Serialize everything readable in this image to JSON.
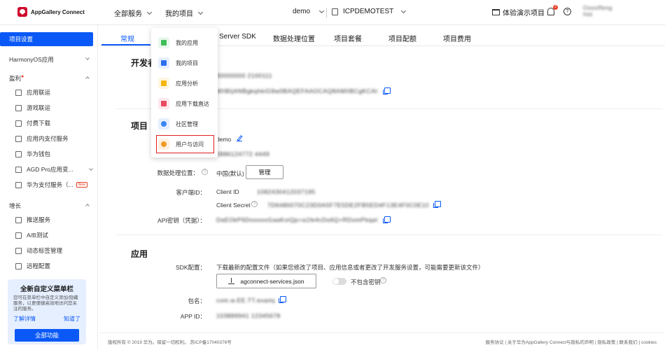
{
  "header": {
    "brand": "AppGallery Connect",
    "nav_all_services": "全部服务",
    "nav_my_projects": "我的项目",
    "app_selector": "demo",
    "project_selector": "ICPDEMOTEST",
    "demo_project": "体验演示项目",
    "notification_count": "2",
    "help": "?",
    "user_name": "Ooooffeng",
    "user_sub": "ffdd"
  },
  "sidebar": {
    "project_settings": "项目设置",
    "harmonyos_app": "HarmonyOS应用",
    "monetize": "盈利",
    "items_monetize": [
      "应用联运",
      "游戏联运",
      "付费下载",
      "应用内支付服务",
      "华为钱包",
      "AGD Pro应用变...",
      "华为支付服务（..."
    ],
    "new_badge": "New",
    "growth": "增长",
    "items_growth": [
      "推送服务",
      "A/B测试",
      "动态标签管理",
      "远程配置"
    ],
    "promo_title": "全新自定义菜单栏",
    "promo_desc": "您可在菜单栏中自定义添加/隐藏服务，以更便捷高效地访问您关注的服务。",
    "promo_learn_more": "了解详情",
    "promo_got_it": "知道了",
    "promo_button": "全部功能"
  },
  "tabs": [
    "常规",
    "Server SDK",
    "数据处理位置",
    "项目套餐",
    "项目配额",
    "项目费用"
  ],
  "dropdown": {
    "items": [
      "我的应用",
      "我的项目",
      "应用分析",
      "应用下载直达",
      "社区管理",
      "用户与访问"
    ],
    "icon_colors": [
      "#3dbe5a",
      "#2e6ff0",
      "#f5b50a",
      "#e84a5f",
      "#3a86f0",
      "#f29b26"
    ]
  },
  "developer": {
    "title": "开发者",
    "value_1": "30000000 2100111",
    "value_2": "MIIBIjANBgkqhkiG9w0BAQEFAAOCAQ8AMIIBCgKCAQEAs..."
  },
  "project": {
    "title": "项目",
    "name": "demo",
    "project_id": "3886124772 4449",
    "data_location_label": "数据处理位置：",
    "data_location_value": "中国(默认)",
    "manage_button": "管理",
    "client_label": "客户端ID：",
    "client_id_label": "Client ID",
    "client_id_value": "1082430412037195",
    "client_secret_label": "Client Secret",
    "client_secret_value": "7D6480070C23D0A5F7E5DE2FB5ED4F13E4F0C0E10...",
    "api_key_label": "API密钥（凭据）：",
    "api_key_value": "DaEOkP6DooooxGaaKoiQp+a1fe4cDs6Q+RDomPkqaCdD..."
  },
  "app": {
    "title": "应用",
    "sdk_label": "SDK配置：",
    "sdk_desc": "下载最新的配置文件（如果您修改了项目、应用信息或者更改了开发服务设置，可能需要更新该文件）",
    "download_button": "agconnect-services.json",
    "exclude_key": "不包含密钥",
    "package_label": "包名：",
    "package_value": "com.w.EE.TT.example.demo",
    "appid_label": "APP ID：",
    "appid_value": "103889941 12345678"
  },
  "footer": {
    "copyright": "版权所有 © 2019 华为。保留一切权利。 苏ICP备17040376号",
    "links": "服务协议 | 关于华为AppGallery Connect与隐私的声明 | 隐私政策 | 联系我们 | cookies"
  },
  "colors": {
    "primary": "#0a59f7",
    "brand": "#cf0a2c",
    "highlight": "#e02020"
  }
}
